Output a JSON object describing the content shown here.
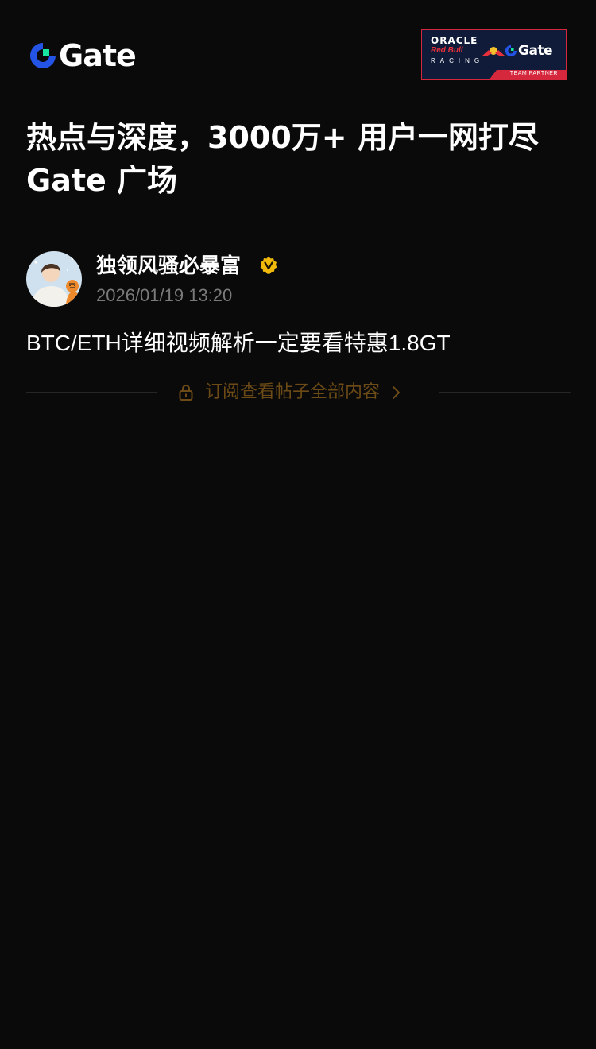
{
  "brand": {
    "logo_text": "Gate",
    "accent_blue": "#2354e6",
    "accent_green": "#17e6a1"
  },
  "partner_badge": {
    "line1": "ORACLE",
    "line2": "Red Bull",
    "line3": "RACING",
    "partner_logo_text": "Gate",
    "tag": "TEAM PARTNER",
    "background": "#0f1b38",
    "accent": "#d5283c"
  },
  "headline": {
    "line1": "热点与深度，3000万+ 用户一网打尽",
    "line2": "Gate 广场"
  },
  "post": {
    "author_name": "独领风骚必暴富",
    "verified_icon": "verified-badge-icon",
    "verified_color": "#f0b90b",
    "timestamp": "2026/01/19 13:20",
    "body": "BTC/ETH详细视频解析一定要看特惠1.8GT"
  },
  "paywall": {
    "label": "订阅查看帖子全部内容",
    "lock_icon": "lock-icon",
    "chevron_icon": "chevron-right-icon",
    "color": "#6d4b16"
  }
}
